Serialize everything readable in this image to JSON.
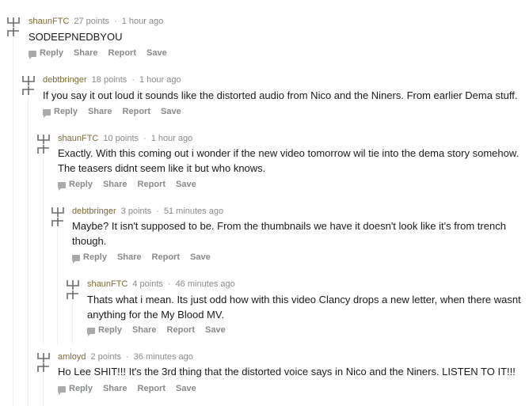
{
  "comments": [
    {
      "author": "shaunFTC",
      "points": "27 points",
      "sep": "·",
      "time": "1 hour ago",
      "body": "SODEEPNEDBYOU",
      "actions": {
        "reply": "Reply",
        "share": "Share",
        "report": "Report",
        "save": "Save"
      }
    },
    {
      "author": "debtbringer",
      "points": "18 points",
      "sep": "·",
      "time": "1 hour ago",
      "body": "If you say it out loud it sounds like the distorted audio from Nico and the Niners. From earlier Dema stuff.",
      "actions": {
        "reply": "Reply",
        "share": "Share",
        "report": "Report",
        "save": "Save"
      }
    },
    {
      "author": "shaunFTC",
      "points": "10 points",
      "sep": "·",
      "time": "1 hour ago",
      "body": "Exactly. With this coming out i wonder if the new video tomorrow wil tie into the dema story somehow. The teasers didnt seem like it but who knows.",
      "actions": {
        "reply": "Reply",
        "share": "Share",
        "report": "Report",
        "save": "Save"
      }
    },
    {
      "author": "debtbringer",
      "points": "3 points",
      "sep": "·",
      "time": "51 minutes ago",
      "body": "Maybe? It isn't supposed to be. From the thumbnails we have it doesn't look like it's from trench though.",
      "actions": {
        "reply": "Reply",
        "share": "Share",
        "report": "Report",
        "save": "Save"
      }
    },
    {
      "author": "shaunFTC",
      "points": "4 points",
      "sep": "·",
      "time": "46 minutes ago",
      "body": "Thats what i mean. Its just odd how with this video Clancy drops a new letter, when there wasnt anything for the My Blood MV.",
      "actions": {
        "reply": "Reply",
        "share": "Share",
        "report": "Report",
        "save": "Save"
      }
    },
    {
      "author": "amloyd",
      "points": "2 points",
      "sep": "·",
      "time": "36 minutes ago",
      "body": "Ho Lee SHIT!!! It's the 3rd thing that the distorted voice says in Nico and the Niners. LISTEN TO IT!!!",
      "actions": {
        "reply": "Reply",
        "share": "Share",
        "report": "Report",
        "save": "Save"
      }
    }
  ],
  "icons": {
    "vote": "trench-glyph-vote-icon",
    "reply": "comment-bubble-icon"
  },
  "colors": {
    "author": "#7c6a32",
    "meta": "#878a8c",
    "text": "#1a1a1b",
    "threadline": "#edeff1"
  }
}
